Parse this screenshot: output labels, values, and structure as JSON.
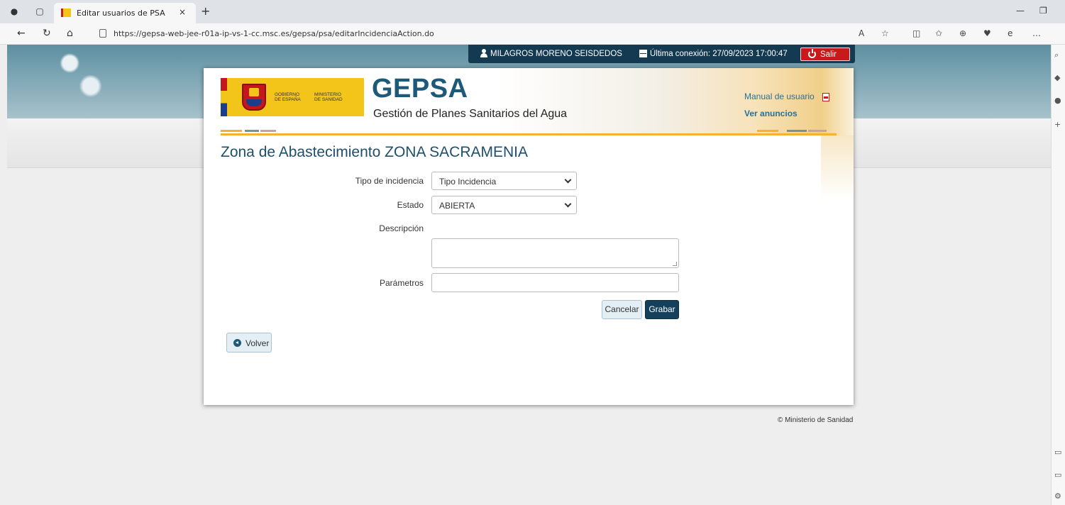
{
  "browser": {
    "tab_title": "Editar usuarios de PSA",
    "tab_close": "×",
    "new_tab": "+",
    "url": "https://gepsa-web-jee-r01a-ip-vs-1-cc.msc.es/gepsa/psa/editarIncidenciaAction.do",
    "toolbar_icons": [
      "read-aloud-icon",
      "favorite-icon",
      "split-screen-icon",
      "favorites-icon",
      "collections-icon",
      "performance-icon",
      "edge-icon",
      "more-icon"
    ]
  },
  "userbar": {
    "user_name": "MILAGROS MORENO SEISDEDOS",
    "last_login": "Última conexión: 27/09/2023 17:00:47",
    "logout_label": "Salir"
  },
  "header": {
    "logo_text_1": "GOBIERNO\nDE ESPAÑA",
    "logo_text_2": "MINISTERIO\nDE SANIDAD",
    "app_name": "GEPSA",
    "app_subtitle": "Gestión de Planes Sanitarios del Agua",
    "manual_link": "Manual de usuario",
    "announcements_link": "Ver anuncios"
  },
  "main": {
    "title": "Zona de Abastecimiento ZONA SACRAMENIA",
    "form": {
      "incident_type_label": "Tipo de incidencia",
      "incident_type_value": "Tipo Incidencia",
      "status_label": "Estado",
      "status_value": "ABIERTA",
      "description_label": "Descripción",
      "description_value": "",
      "parameters_label": "Parámetros",
      "parameters_value": ""
    },
    "cancel_label": "Cancelar",
    "save_label": "Grabar",
    "back_label": "Volver"
  },
  "footer": {
    "copyright": "© Ministerio de Sanidad"
  },
  "colors": {
    "brand_dark": "#143a52",
    "brand_title": "#1d5a7a",
    "danger": "#c81a1a",
    "accent_stripe": "#f3b231",
    "logo_yellow": "#f3c419"
  }
}
